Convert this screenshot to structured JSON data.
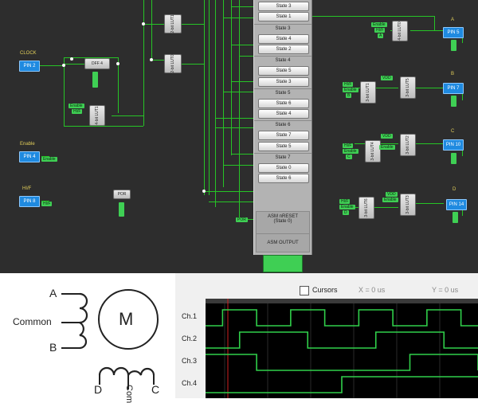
{
  "schematic": {
    "clock_label": "CLOCK",
    "pin2": "PIN 2",
    "dff_label": "DFF 4",
    "lut1_label": "2-bit LUT1",
    "lut0_label": "2-bit LUT0",
    "lut4bit_label": "4-bit LUT1",
    "enable_label": "Enable",
    "pin4": "PIN 4",
    "pin4_tag": "Enable",
    "hf_label": "HI/F",
    "pin8": "PIN 8",
    "pin8_tag": "HI/F",
    "por_label": "POR",
    "por_tag": "POR",
    "enable_tag": "Enable",
    "hf_tag": "HI/F",
    "outputs": [
      {
        "letter": "A",
        "pin": "PIN 5",
        "lut": "4-bit LUT0"
      },
      {
        "letter": "B",
        "pin": "PIN 7",
        "lut": "3-bit LUT5"
      },
      {
        "letter": "C",
        "pin": "PIN 10",
        "lut": "3-bit LUT2"
      },
      {
        "letter": "D",
        "pin": "PIN 14",
        "lut": "3-bit LUT3"
      }
    ],
    "lut_left": [
      "3-bit LUT1",
      "3-bit LUT4",
      "3-bit LUT6"
    ],
    "tags_b": [
      "HI/F",
      "Enable",
      "B"
    ],
    "tags_c": [
      "HI/F",
      "Enable",
      "C"
    ],
    "tags_d": [
      "HI/F",
      "Enable",
      "D"
    ],
    "tags_a": [
      "Enable",
      "HI/F",
      "A"
    ],
    "vdd_tag": "VDD"
  },
  "asm": {
    "items": [
      {
        "kind": "button",
        "text": "State 3"
      },
      {
        "kind": "button",
        "text": "State 1"
      },
      {
        "kind": "header",
        "text": "State 3"
      },
      {
        "kind": "button",
        "text": "State 4"
      },
      {
        "kind": "button",
        "text": "State 2"
      },
      {
        "kind": "header",
        "text": "State 4"
      },
      {
        "kind": "button",
        "text": "State 5"
      },
      {
        "kind": "button",
        "text": "State 3"
      },
      {
        "kind": "header",
        "text": "State 5"
      },
      {
        "kind": "button",
        "text": "State 6"
      },
      {
        "kind": "button",
        "text": "State 4"
      },
      {
        "kind": "header",
        "text": "State 6"
      },
      {
        "kind": "button",
        "text": "State 7"
      },
      {
        "kind": "button",
        "text": "State 5"
      },
      {
        "kind": "header",
        "text": "State 7"
      },
      {
        "kind": "button",
        "text": "State 0"
      },
      {
        "kind": "button",
        "text": "State 6"
      }
    ],
    "nreset_label": "ASM nRESET",
    "nreset_sub": "(State 0)",
    "output_label": "ASM OUTPUT"
  },
  "motor": {
    "a_label": "A",
    "common_label": "Common",
    "b_label": "B",
    "m_label": "M",
    "d_label": "D",
    "common_bottom": "Com",
    "c_label": "C"
  },
  "scope": {
    "cursors_label": "Cursors",
    "x_readout": "X = 0 us",
    "y_readout": "Y = 0 us",
    "channels": [
      "Ch.1",
      "Ch.2",
      "Ch.3",
      "Ch.4"
    ],
    "trace_color": "#30d04a",
    "levels": [
      [
        0,
        1,
        1,
        0,
        0,
        1,
        1,
        0,
        0,
        1,
        1,
        0,
        0,
        1,
        1,
        0,
        0
      ],
      [
        0,
        0,
        1,
        1,
        1,
        1,
        0,
        0,
        0,
        0,
        1,
        1,
        1,
        1,
        0,
        0,
        0
      ],
      [
        1,
        1,
        1,
        0,
        0,
        0,
        0,
        0,
        0,
        0,
        0,
        0,
        1,
        1,
        1,
        1,
        0
      ],
      [
        0,
        0,
        0,
        0,
        0,
        0,
        0,
        0,
        1,
        1,
        1,
        1,
        1,
        1,
        1,
        1,
        1
      ]
    ]
  }
}
